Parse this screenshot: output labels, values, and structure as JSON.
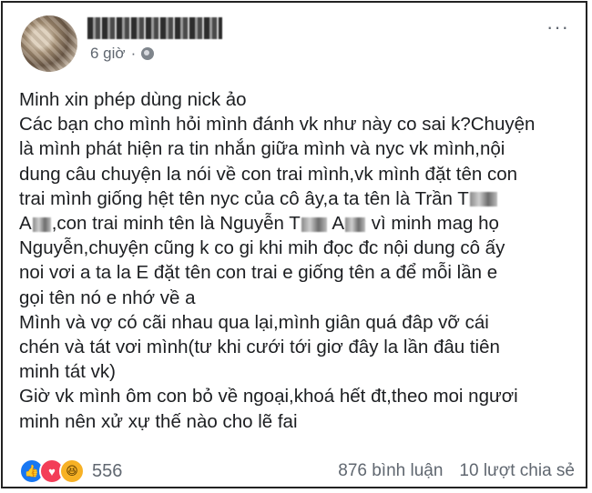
{
  "post": {
    "time": "6 giờ",
    "separator": "·",
    "lines": {
      "l1": "Minh xin phép dùng nick ảo",
      "l2": "Các bạn cho mình hỏi mình đánh vk như này co sai k?Chuyện",
      "l3": "là mình phát hiện ra tin nhắn giữa mình và nyc vk mình,nội",
      "l4": "dung câu chuyện la nói về con trai mình,vk mình đặt tên con",
      "l5": "trai mình giống hệt tên nyc của cô ây,a ta tên là Trần T",
      "l6a": "A",
      "l6b": ",con trai minh tên là Nguyễn T",
      "l6c": "A",
      "l6d": "vì minh mag họ",
      "l7": "Nguyễn,chuyện cũng k co gi khi mih đọc đc nội dung cô ấy",
      "l8": "noi vơi a ta la E đặt tên con trai e giống tên a để mỗi lần e",
      "l9": "gọi tên nó e nhớ về a",
      "l10": "Mình và vợ có cãi nhau qua lại,mình giân quá đâp vỡ cái",
      "l11": "chén và tát vơi mình(tư khi cưới tới giơ đây la lần đâu tiên",
      "l12": "minh tát vk)",
      "l13": "Giờ vk mình ôm con bỏ về ngoại,khoá hết đt,theo moi ngươi",
      "l14": "minh nên xử xự thế nào cho lẽ fai"
    }
  },
  "footer": {
    "reaction_count": "556",
    "comments": "876 bình luận",
    "shares": "10 lượt chia sẻ",
    "reaction_icons": [
      "like-icon",
      "love-icon",
      "haha-icon"
    ]
  },
  "icons": {
    "like": "👍",
    "love": "♥",
    "haha": "😆",
    "more": "···"
  },
  "colors": {
    "like": "#1877f2",
    "love": "#f33e58",
    "haha": "#f7b125",
    "meta_text": "#606770"
  }
}
